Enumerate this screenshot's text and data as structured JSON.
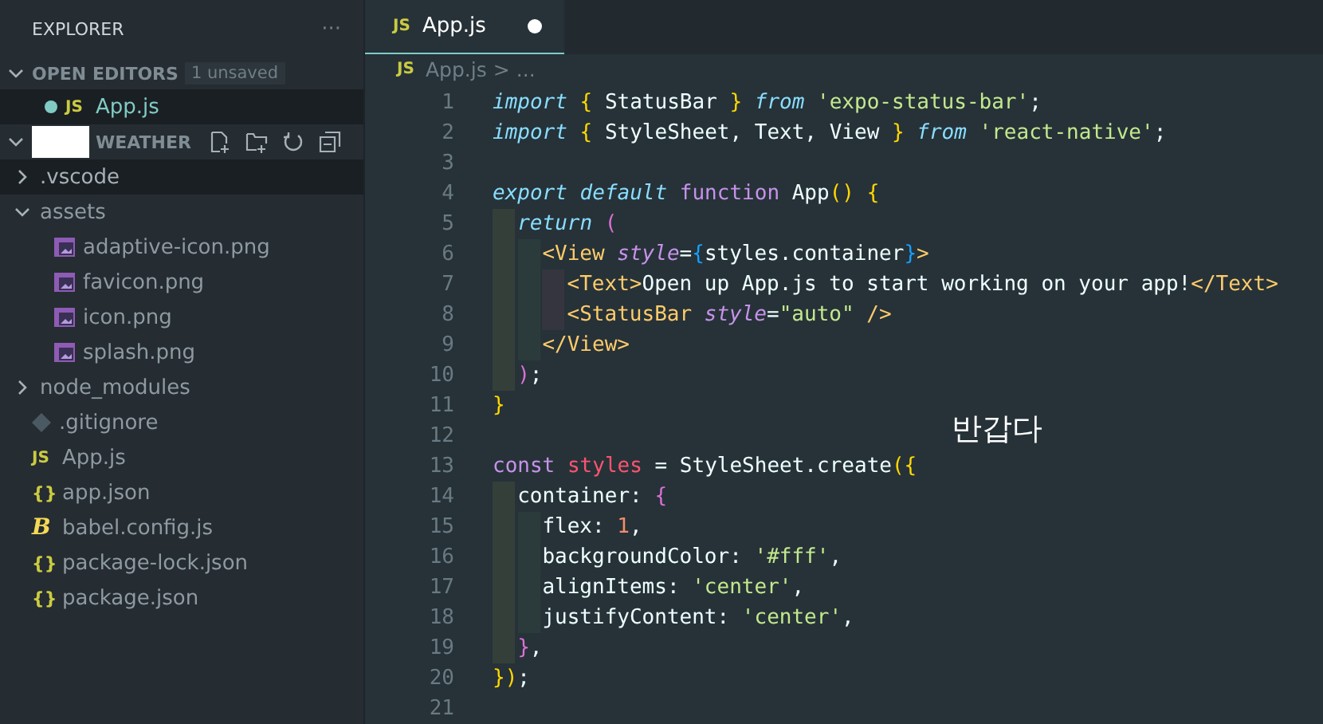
{
  "sidebar": {
    "title": "EXPLORER",
    "more": "···",
    "open_editors": {
      "label": "OPEN EDITORS",
      "expanded": true,
      "badge": "1 unsaved",
      "items": [
        {
          "name": "App.js",
          "kind": "js",
          "icon": "JS",
          "dirty": true,
          "selected": true
        }
      ]
    },
    "folder": {
      "label": "WEATHER",
      "expanded": true,
      "redacted": true,
      "items": [
        {
          "name": ".vscode",
          "kind": "folder",
          "expanded": false,
          "selected": true
        },
        {
          "name": "assets",
          "kind": "folder",
          "expanded": true,
          "selected": false,
          "children": [
            {
              "name": "adaptive-icon.png",
              "kind": "image",
              "selected": false
            },
            {
              "name": "favicon.png",
              "kind": "image",
              "selected": false
            },
            {
              "name": "icon.png",
              "kind": "image",
              "selected": false
            },
            {
              "name": "splash.png",
              "kind": "image",
              "selected": false
            }
          ]
        },
        {
          "name": "node_modules",
          "kind": "folder",
          "expanded": false,
          "selected": false
        },
        {
          "name": ".gitignore",
          "kind": "git",
          "selected": false
        },
        {
          "name": "App.js",
          "kind": "js",
          "icon": "JS",
          "selected": false
        },
        {
          "name": "app.json",
          "kind": "json",
          "icon": "{}",
          "selected": false
        },
        {
          "name": "babel.config.js",
          "kind": "babel",
          "icon": "B",
          "selected": false
        },
        {
          "name": "package-lock.json",
          "kind": "json",
          "icon": "{}",
          "selected": false
        },
        {
          "name": "package.json",
          "kind": "json",
          "icon": "{}",
          "selected": false
        }
      ]
    }
  },
  "tabs": [
    {
      "label": "App.js",
      "kind": "js",
      "icon": "JS",
      "dirty": true,
      "selected": true
    }
  ],
  "breadcrumb": {
    "icon": "JS",
    "file": "App.js",
    "separator": ">",
    "rest": "..."
  },
  "editor": {
    "lines": [
      {
        "n": "1",
        "tokens": [
          {
            "kind": "kw",
            "text": "import "
          },
          {
            "kind": "br",
            "text": "{ "
          },
          {
            "kind": "p",
            "text": "StatusBar "
          },
          {
            "kind": "br",
            "text": "} "
          },
          {
            "kind": "kw",
            "text": "from "
          },
          {
            "kind": "str",
            "text": "'expo-status-bar'"
          },
          {
            "kind": "p",
            "text": ";"
          }
        ]
      },
      {
        "n": "2",
        "tokens": [
          {
            "kind": "kw",
            "text": "import "
          },
          {
            "kind": "br",
            "text": "{ "
          },
          {
            "kind": "p",
            "text": "StyleSheet, Text, View "
          },
          {
            "kind": "br",
            "text": "} "
          },
          {
            "kind": "kw",
            "text": "from "
          },
          {
            "kind": "str",
            "text": "'react-native'"
          },
          {
            "kind": "p",
            "text": ";"
          }
        ]
      },
      {
        "n": "3"
      },
      {
        "n": "4",
        "tokens": [
          {
            "kind": "kw",
            "text": "export default "
          },
          {
            "kind": "fn",
            "text": "function "
          },
          {
            "kind": "p",
            "text": "App"
          },
          {
            "kind": "br",
            "text": "() {"
          }
        ],
        "children": [
          {
            "n": "5",
            "tokens": [
              {
                "kind": "kw",
                "text": "return "
              },
              {
                "kind": "br2",
                "text": "("
              }
            ],
            "children": [
              {
                "n": "6",
                "tokens": [
                  {
                    "kind": "tag",
                    "text": "<View "
                  },
                  {
                    "kind": "attr",
                    "text": "style"
                  },
                  {
                    "kind": "p",
                    "text": "="
                  },
                  {
                    "kind": "br3",
                    "text": "{"
                  },
                  {
                    "kind": "p",
                    "text": "styles.container"
                  },
                  {
                    "kind": "br3",
                    "text": "}"
                  },
                  {
                    "kind": "tag",
                    "text": ">"
                  }
                ],
                "children": [
                  {
                    "n": "7",
                    "tokens": [
                      {
                        "kind": "tag",
                        "text": "<Text>"
                      },
                      {
                        "kind": "p",
                        "text": "Open up App.js to start working on your app!"
                      },
                      {
                        "kind": "tag",
                        "text": "</Text>"
                      }
                    ]
                  },
                  {
                    "n": "8",
                    "tokens": [
                      {
                        "kind": "tag",
                        "text": "<StatusBar "
                      },
                      {
                        "kind": "attr",
                        "text": "style"
                      },
                      {
                        "kind": "p",
                        "text": "="
                      },
                      {
                        "kind": "str",
                        "text": "\"auto\" "
                      },
                      {
                        "kind": "tag",
                        "text": "/>"
                      }
                    ]
                  }
                ]
              },
              {
                "n": "9",
                "tokens": [
                  {
                    "kind": "tag",
                    "text": "</View>"
                  }
                ]
              }
            ]
          },
          {
            "n": "10",
            "tokens": [
              {
                "kind": "br2",
                "text": ")"
              },
              {
                "kind": "p",
                "text": ";"
              }
            ]
          }
        ]
      },
      {
        "n": "11",
        "tokens": [
          {
            "kind": "br",
            "text": "}"
          }
        ]
      },
      {
        "n": "12"
      },
      {
        "n": "13",
        "tokens": [
          {
            "kind": "fn",
            "text": "const "
          },
          {
            "kind": "var",
            "text": "styles "
          },
          {
            "kind": "p",
            "text": "= StyleSheet.create"
          },
          {
            "kind": "br",
            "text": "({"
          }
        ],
        "children": [
          {
            "n": "14",
            "tokens": [
              {
                "kind": "p",
                "text": "container: "
              },
              {
                "kind": "br2",
                "text": "{"
              }
            ],
            "children": [
              {
                "n": "15",
                "tokens": [
                  {
                    "kind": "p",
                    "text": "flex: "
                  },
                  {
                    "kind": "num",
                    "text": "1"
                  },
                  {
                    "kind": "p",
                    "text": ","
                  }
                ]
              },
              {
                "n": "16",
                "tokens": [
                  {
                    "kind": "p",
                    "text": "backgroundColor: "
                  },
                  {
                    "kind": "str",
                    "text": "'#fff'"
                  },
                  {
                    "kind": "p",
                    "text": ","
                  }
                ]
              },
              {
                "n": "17",
                "tokens": [
                  {
                    "kind": "p",
                    "text": "alignItems: "
                  },
                  {
                    "kind": "str",
                    "text": "'center'"
                  },
                  {
                    "kind": "p",
                    "text": ","
                  }
                ]
              },
              {
                "n": "18",
                "tokens": [
                  {
                    "kind": "p",
                    "text": "justifyContent: "
                  },
                  {
                    "kind": "str",
                    "text": "'center'"
                  },
                  {
                    "kind": "p",
                    "text": ","
                  }
                ]
              }
            ]
          },
          {
            "n": "19",
            "tokens": [
              {
                "kind": "br2",
                "text": "}"
              },
              {
                "kind": "p",
                "text": ","
              }
            ]
          }
        ]
      },
      {
        "n": "20",
        "tokens": [
          {
            "kind": "br",
            "text": "})"
          },
          {
            "kind": "p",
            "text": ";"
          }
        ]
      },
      {
        "n": "21"
      }
    ],
    "overlay_text": "반갑다"
  }
}
